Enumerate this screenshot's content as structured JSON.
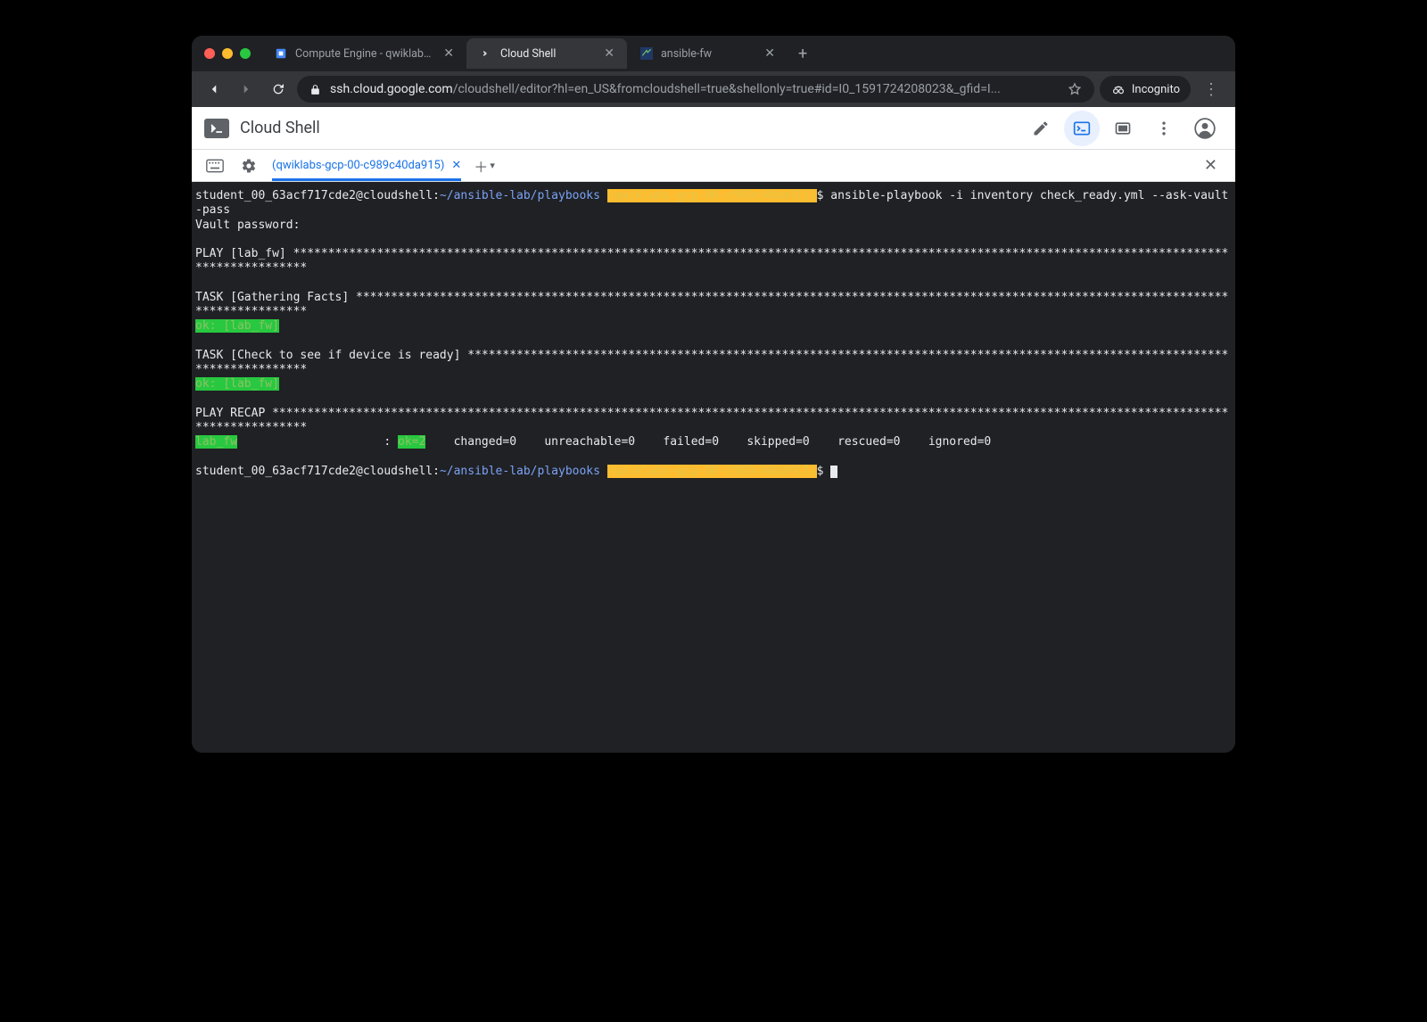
{
  "browser": {
    "tabs": [
      {
        "label": "Compute Engine - qwiklabs-gc",
        "favicon": "gce"
      },
      {
        "label": "Cloud Shell",
        "favicon": "cloudshell"
      },
      {
        "label": "ansible-fw",
        "favicon": "panw"
      }
    ],
    "active_tab": 1,
    "url_host": "ssh.cloud.google.com",
    "url_path": "/cloudshell/editor?hl=en_US&fromcloudshell=true&shellonly=true#id=I0_1591724208023&_gfid=I...",
    "incognito_label": "Incognito"
  },
  "cloudshell": {
    "title": "Cloud Shell",
    "terminal_tab_label": "(qwiklabs-gcp-00-c989c40da915)"
  },
  "terminal": {
    "prompt_user": "student_00_63acf717cde2@cloudshell",
    "prompt_path": "~/ansible-lab/playbooks",
    "prompt_ctx": "(qwiklabs-gcp-00-c989c40da915)",
    "command1": "ansible-playbook -i inventory check_ready.yml --ask-vault-pass",
    "vault_password_label": "Vault password:",
    "play_header": "PLAY [lab_fw] ",
    "task_gather_header": "TASK [Gathering Facts] ",
    "ok_labfw": "ok: [lab_fw]",
    "task_check_header": "TASK [Check to see if device is ready] ",
    "play_recap_header": "PLAY RECAP ",
    "recap_host": "lab_fw",
    "recap_ok": "ok=2",
    "recap_rest": "    changed=0    unreachable=0    failed=0    skipped=0    rescued=0    ignored=0"
  }
}
